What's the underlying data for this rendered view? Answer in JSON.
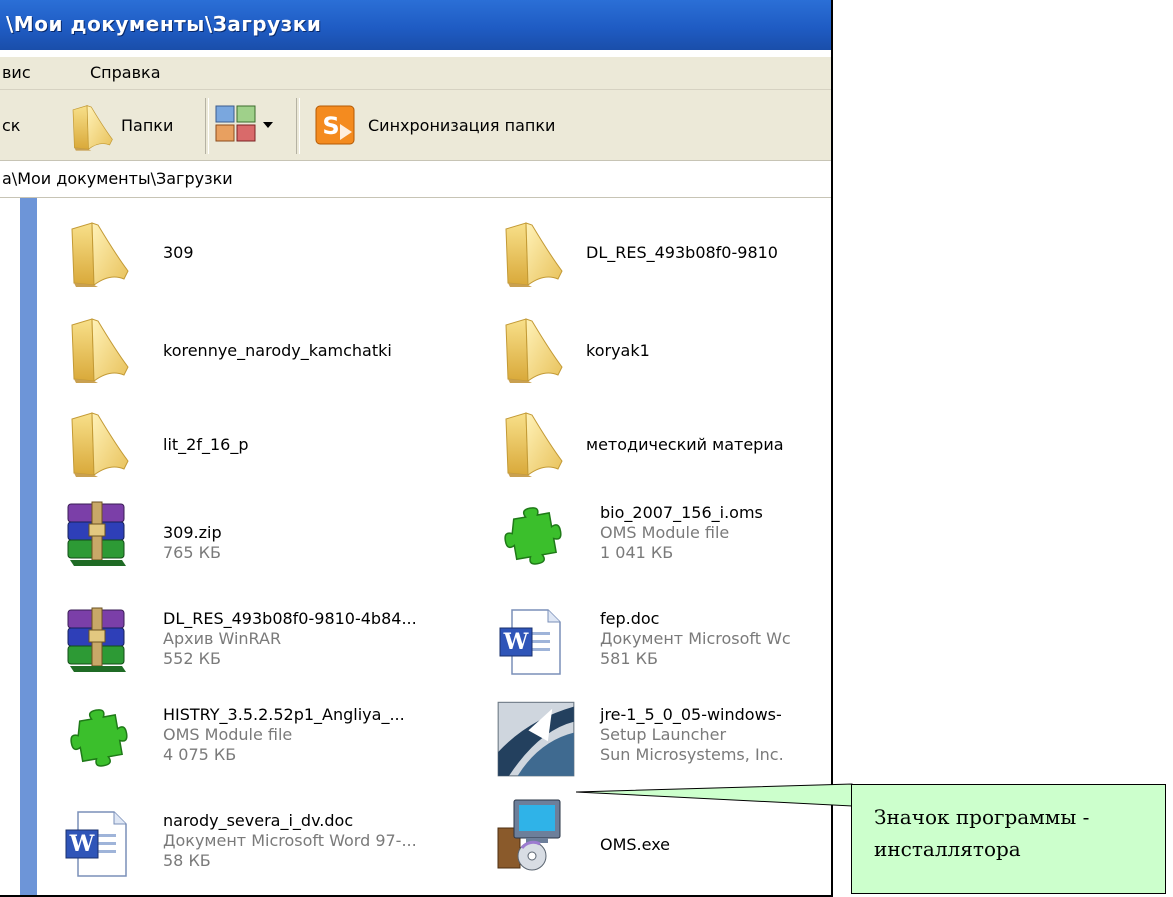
{
  "window": {
    "title": "\\Мои документы\\Загрузки"
  },
  "menu": [
    "вис",
    "Справка"
  ],
  "toolbar": {
    "search_partial": "ск",
    "folders_label": "Папки",
    "sync_label": "Синхронизация папки"
  },
  "address": "а\\Мои документы\\Загрузки",
  "files": [
    {
      "name": "309",
      "line2": "",
      "line3": "",
      "icon": "folder-icon"
    },
    {
      "name": "DL_RES_493b08f0-9810",
      "line2": "",
      "line3": "",
      "icon": "folder-icon"
    },
    {
      "name": "korennye_narody_kamchatki",
      "line2": "",
      "line3": "",
      "icon": "folder-icon"
    },
    {
      "name": "koryak1",
      "line2": "",
      "line3": "",
      "icon": "folder-icon"
    },
    {
      "name": "lit_2f_16_p",
      "line2": "",
      "line3": "",
      "icon": "folder-icon"
    },
    {
      "name": "методический материа",
      "line2": "",
      "line3": "",
      "icon": "folder-icon"
    },
    {
      "name": "309.zip",
      "line2": "765 КБ",
      "line3": "",
      "icon": "winrar-archive-icon"
    },
    {
      "name": "bio_2007_156_i.oms",
      "line2": "OMS Module file",
      "line3": "1 041 КБ",
      "icon": "puzzle-icon"
    },
    {
      "name": "DL_RES_493b08f0-9810-4b84...",
      "line2": "Архив WinRAR",
      "line3": "552 КБ",
      "icon": "winrar-archive-icon"
    },
    {
      "name": "fep.doc",
      "line2": "Документ Microsoft Wc",
      "line3": "581 КБ",
      "icon": "word-document-icon"
    },
    {
      "name": "HISTRY_3.5.2.52p1_Angliya_...",
      "line2": "OMS Module file",
      "line3": "4 075 КБ",
      "icon": "puzzle-icon"
    },
    {
      "name": "jre-1_5_0_05-windows-",
      "line2": "Setup Launcher",
      "line3": "Sun Microsystems, Inc.",
      "icon": "setup-launcher-icon"
    },
    {
      "name": "narody_severa_i_dv.doc",
      "line2": "Документ Microsoft Word 97-...",
      "line3": "58 КБ",
      "icon": "word-document-icon"
    },
    {
      "name": "OMS.exe",
      "line2": "",
      "line3": "",
      "icon": "installer-icon"
    }
  ],
  "callout": {
    "line1": "Значок программы -",
    "line2": "инсталлятора"
  },
  "colors": {
    "titlebar": "#1f5cc4",
    "toolbar_bg": "#ece9d8",
    "leftpane": "#6d95d8",
    "callout_bg": "#ccffcc"
  }
}
